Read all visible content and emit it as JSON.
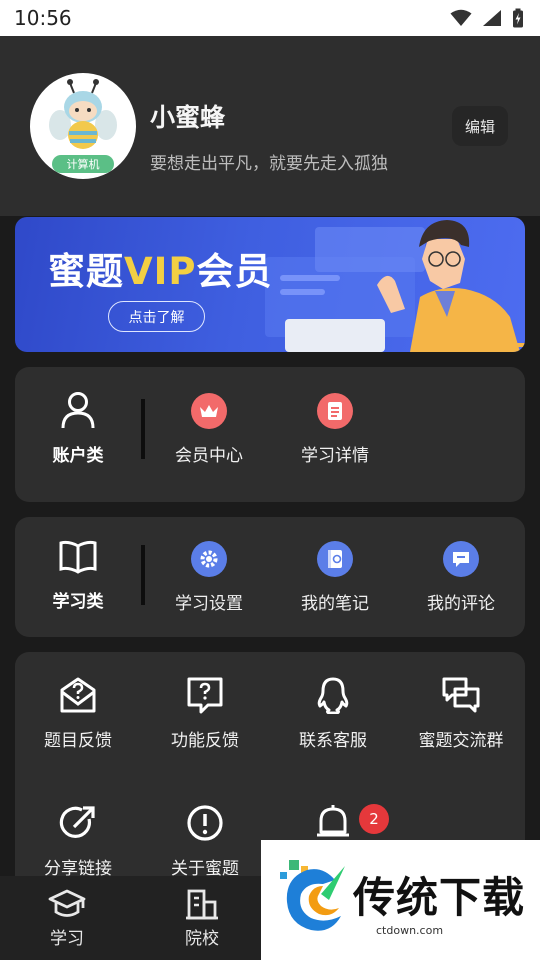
{
  "status_bar": {
    "time": "10:56"
  },
  "profile": {
    "avatar_caption": "计算机",
    "name": "小蜜蜂",
    "motto": "要想走出平凡，就要先走入孤独",
    "edit_label": "编辑"
  },
  "banner": {
    "title_part1": "蜜题",
    "title_vip": "VIP",
    "title_part2": "会员",
    "button_label": "点击了解"
  },
  "account_section": {
    "category": {
      "label": "账户类",
      "icon": "user-icon"
    },
    "items": [
      {
        "label": "会员中心",
        "icon": "crown-icon",
        "color": "#f26a6a"
      },
      {
        "label": "学习详情",
        "icon": "document-icon",
        "color": "#f26a6a"
      }
    ]
  },
  "study_section": {
    "category": {
      "label": "学习类",
      "icon": "book-icon"
    },
    "items": [
      {
        "label": "学习设置",
        "icon": "gear-icon",
        "color": "#5b7ee8"
      },
      {
        "label": "我的笔记",
        "icon": "notebook-icon",
        "color": "#5b7ee8"
      },
      {
        "label": "我的评论",
        "icon": "comment-icon",
        "color": "#5b7ee8"
      }
    ]
  },
  "tools_section": {
    "items": [
      {
        "label": "题目反馈",
        "icon": "question-mail-icon"
      },
      {
        "label": "功能反馈",
        "icon": "question-bubble-icon"
      },
      {
        "label": "联系客服",
        "icon": "qq-icon"
      },
      {
        "label": "蜜题交流群",
        "icon": "chat-group-icon"
      },
      {
        "label": "分享链接",
        "icon": "share-icon"
      },
      {
        "label": "关于蜜题",
        "icon": "info-icon"
      },
      {
        "label": "",
        "icon": "bell-icon",
        "badge": "2"
      }
    ]
  },
  "bottom_nav": {
    "items": [
      {
        "label": "学习",
        "icon": "graduation-cap-icon"
      },
      {
        "label": "院校",
        "icon": "building-icon"
      }
    ]
  },
  "watermark": {
    "title": "传统下载",
    "url": "ctdown.com"
  }
}
